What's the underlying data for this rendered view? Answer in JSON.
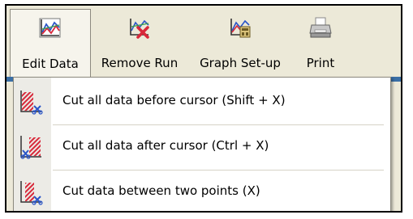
{
  "toolbar": {
    "buttons": [
      {
        "label": "Edit Data",
        "icon": "edit-data-graph-icon",
        "active": true
      },
      {
        "label": "Remove Run",
        "icon": "remove-run-icon",
        "active": false
      },
      {
        "label": "Graph Set-up",
        "icon": "graph-setup-icon",
        "active": false
      },
      {
        "label": "Print",
        "icon": "printer-icon",
        "active": false
      }
    ]
  },
  "menu": {
    "items": [
      {
        "label": "Cut all data before cursor (Shift + X)",
        "icon": "cut-before-cursor-icon"
      },
      {
        "label": "Cut all data after cursor (Ctrl + X)",
        "icon": "cut-after-cursor-icon"
      },
      {
        "label": "Cut data between two points (X)",
        "icon": "cut-between-points-icon"
      }
    ]
  },
  "colors": {
    "toolbar_bg": "#ece9d8",
    "menu_bg": "#ffffff",
    "selection_bar": "#3a6ea5",
    "icon_red": "#d8283a",
    "icon_blue": "#2a55c8"
  }
}
